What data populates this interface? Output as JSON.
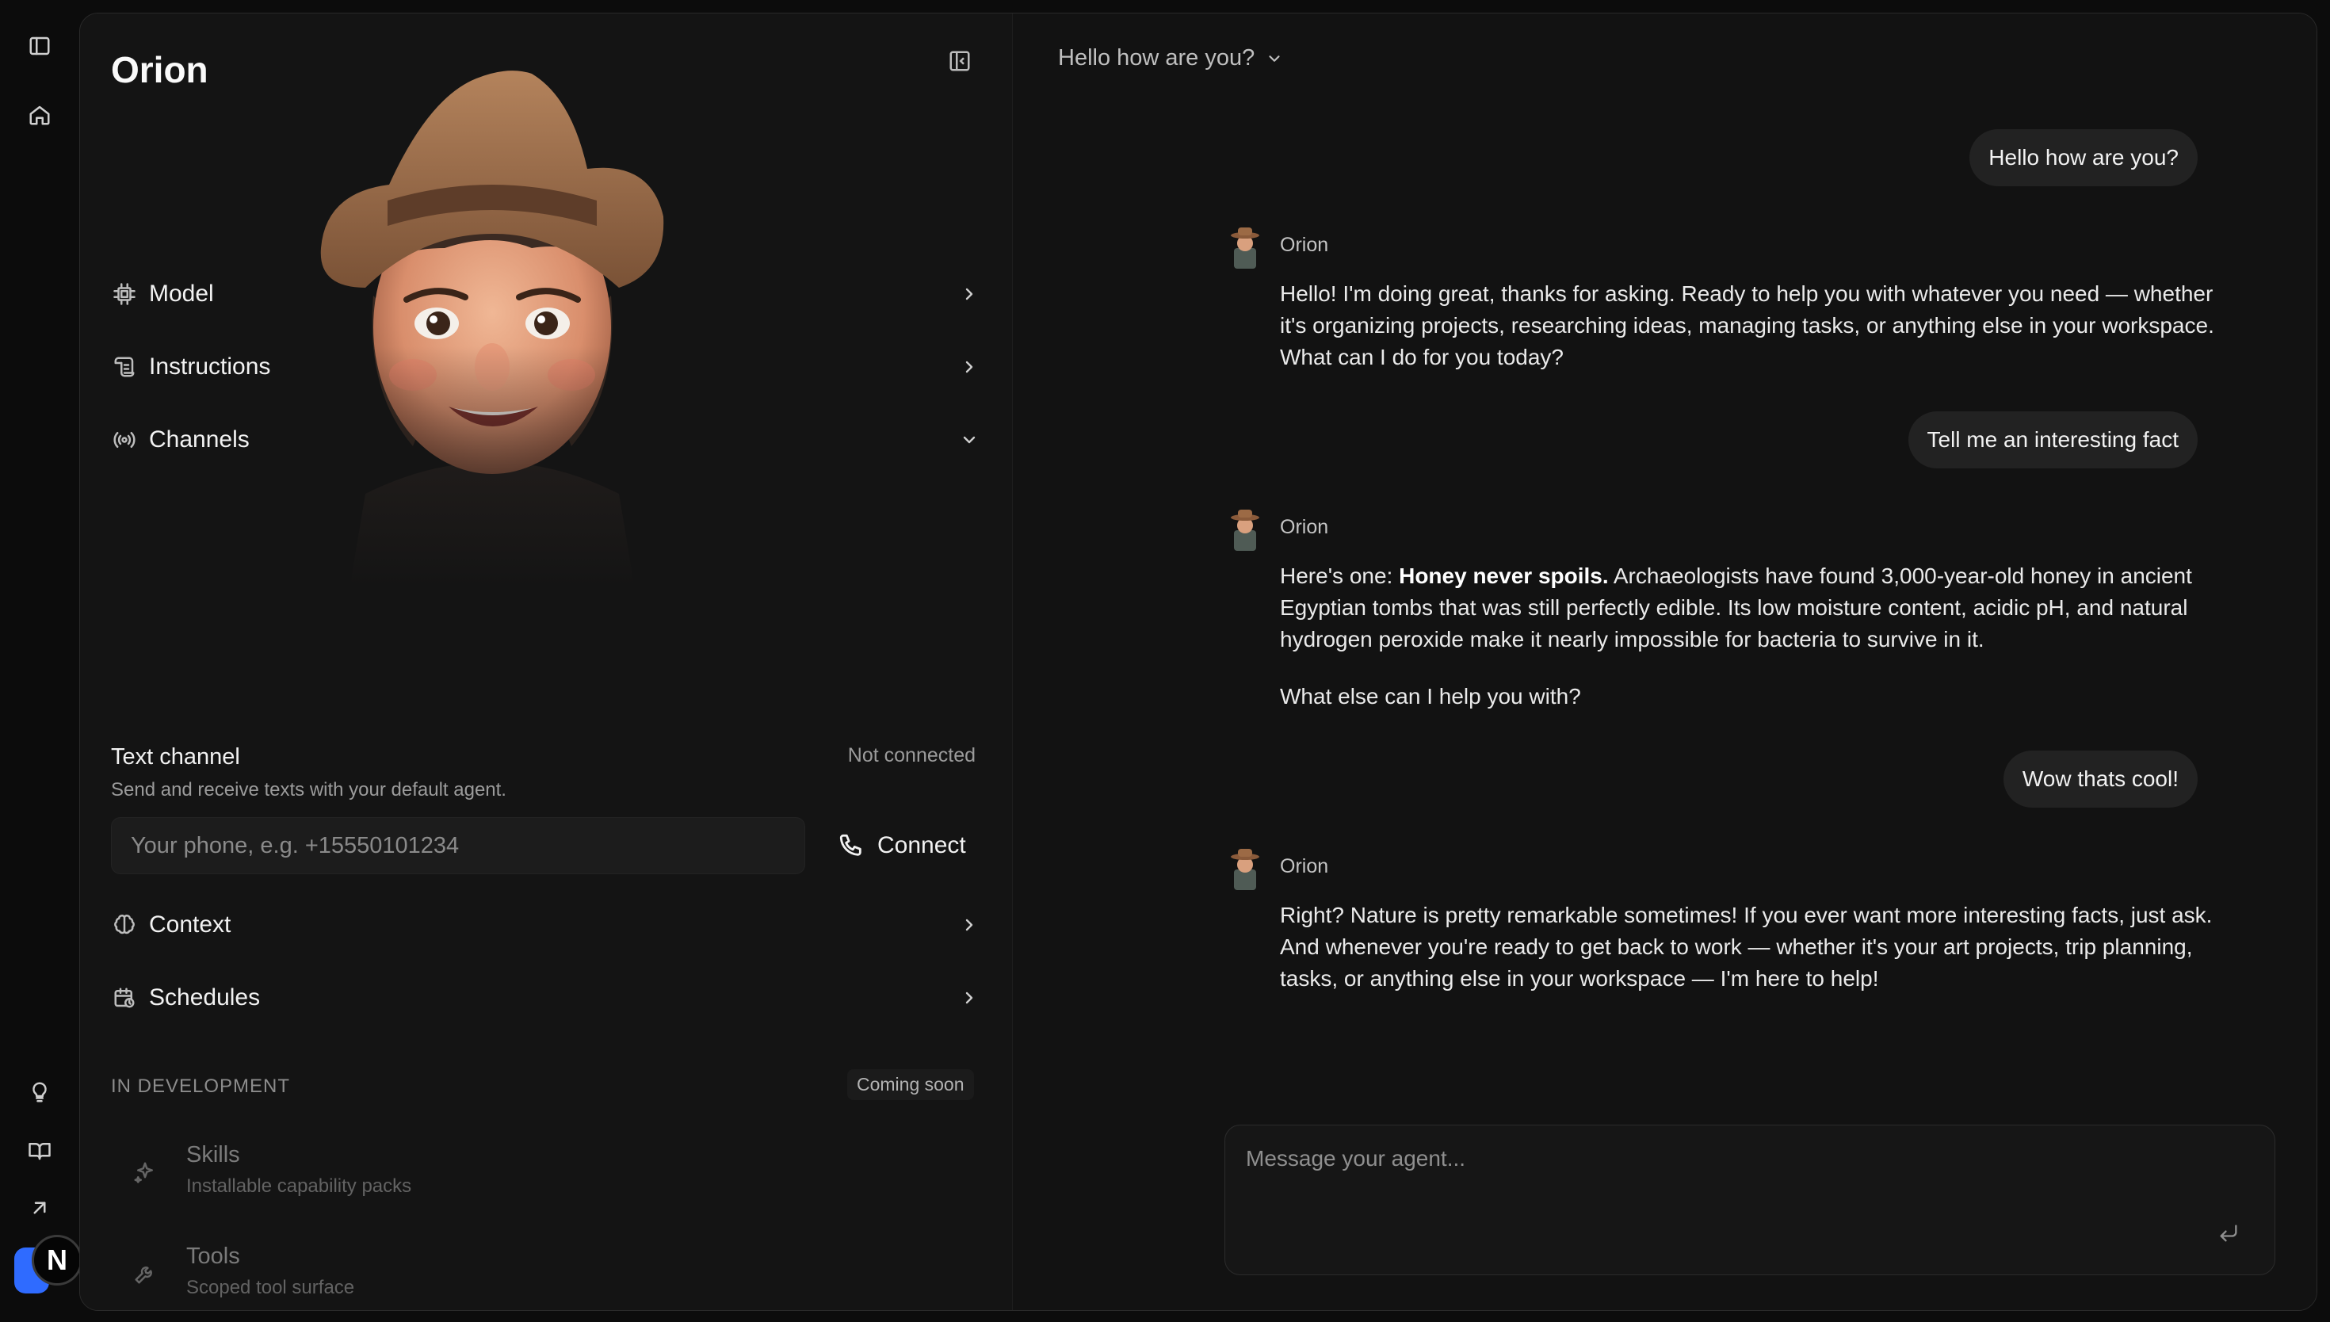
{
  "rail": {
    "icons": [
      "sidebar-toggle-icon",
      "home-icon",
      "lightbulb-icon",
      "book-icon",
      "arrow-up-right-icon"
    ],
    "user_initial": "N",
    "accent": "#2f6bff"
  },
  "agent": {
    "name": "Orion"
  },
  "settings": {
    "model_label": "Model",
    "instructions_label": "Instructions",
    "channels_label": "Channels",
    "text_channel": {
      "title": "Text channel",
      "description": "Send and receive texts with your default agent.",
      "status": "Not connected",
      "phone_placeholder": "Your phone, e.g. +15550101234",
      "connect_label": "Connect"
    },
    "context_label": "Context",
    "schedules_label": "Schedules",
    "in_development": {
      "heading": "IN DEVELOPMENT",
      "badge": "Coming soon",
      "items": [
        {
          "title": "Skills",
          "subtitle": "Installable capability packs"
        },
        {
          "title": "Tools",
          "subtitle": "Scoped tool surface"
        }
      ]
    }
  },
  "conversation": {
    "title": "Hello how are you?",
    "messages": [
      {
        "role": "user",
        "text": "Hello how are you?"
      },
      {
        "role": "agent",
        "name": "Orion",
        "text": "Hello! I'm doing great, thanks for asking. Ready to help you with whatever you need — whether it's organizing projects, researching ideas, managing tasks, or anything else in your workspace. What can I do for you today?"
      },
      {
        "role": "user",
        "text": "Tell me an interesting fact"
      },
      {
        "role": "agent",
        "name": "Orion",
        "bold_lead": "Honey never spoils.",
        "intro": "Here's one: ",
        "text": " Archaeologists have found 3,000-year-old honey in ancient Egyptian tombs that was still perfectly edible. Its low moisture content, acidic pH, and natural hydrogen peroxide make it nearly impossible for bacteria to survive in it.",
        "followup": "What else can I help you with?"
      },
      {
        "role": "user",
        "text": "Wow thats cool!"
      },
      {
        "role": "agent",
        "name": "Orion",
        "text": "Right? Nature is pretty remarkable sometimes! If you ever want more interesting facts, just ask. And whenever you're ready to get back to work — whether it's your art projects, trip planning, tasks, or anything else in your workspace — I'm here to help!"
      }
    ]
  },
  "composer": {
    "placeholder": "Message your agent..."
  }
}
